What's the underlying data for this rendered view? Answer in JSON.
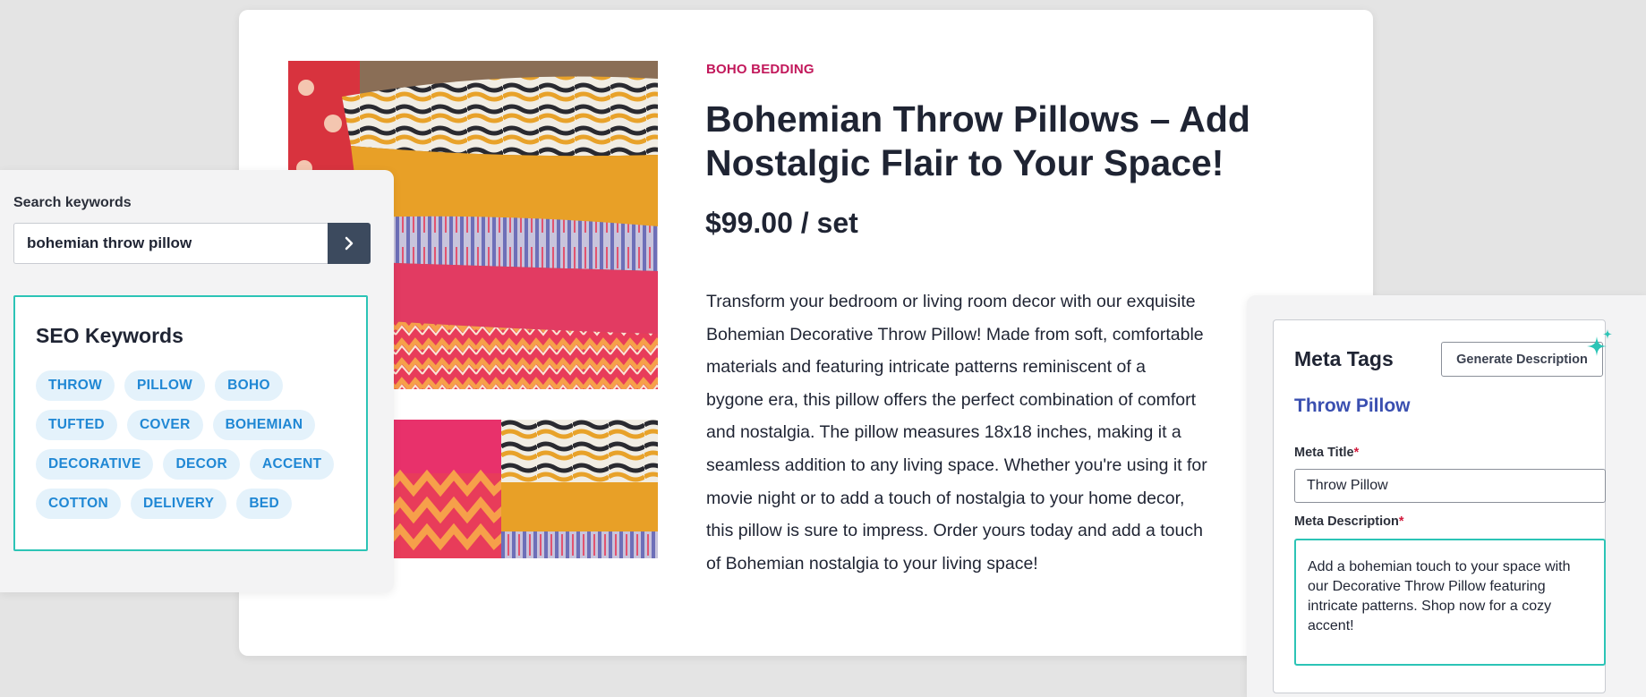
{
  "product": {
    "category": "BOHO BEDDING",
    "title": "Bohemian Throw Pillows – Add Nostalgic Flair to Your Space!",
    "price": "$99.00 / set",
    "description": "Transform your bedroom or living room decor with our exquisite Bohemian Decorative Throw Pillow! Made from soft, comfortable materials and featuring intricate patterns reminiscent of a bygone era, this pillow offers the perfect combination of comfort and nostalgia. The pillow measures 18x18 inches, making it a seamless addition to any living space. Whether you're using it for movie night or to add a touch of nostalgia to your home decor, this pillow is sure to impress. Order yours today and add a touch of Bohemian nostalgia to your living space!"
  },
  "search": {
    "label": "Search keywords",
    "value": "bohemian throw pillow",
    "button_icon": "chevron-right-icon"
  },
  "seo": {
    "title": "SEO Keywords",
    "keywords": [
      "THROW",
      "PILLOW",
      "BOHO",
      "TUFTED",
      "COVER",
      "BOHEMIAN",
      "DECORATIVE",
      "DECOR",
      "ACCENT",
      "COTTON",
      "DELIVERY",
      "BED"
    ]
  },
  "meta": {
    "title": "Meta Tags",
    "generate_button": "Generate Description",
    "generate_icon": "sparkle-icon",
    "product_name": "Throw Pillow",
    "meta_title_label": "Meta Title",
    "meta_title_value": "Throw Pillow",
    "meta_description_label": "Meta Description",
    "required_marker": "*",
    "meta_description_value": "Add a bohemian touch to your space with our Decorative Throw Pillow featuring intricate patterns. Shop now for a cozy accent!"
  },
  "colors": {
    "accent_teal": "#2cc4b6",
    "category_red": "#c2185b",
    "tag_blue": "#1f87d4",
    "tag_bg": "#e4f2fb",
    "product_name_blue": "#3a4fb0",
    "search_button": "#3c4a5e"
  }
}
